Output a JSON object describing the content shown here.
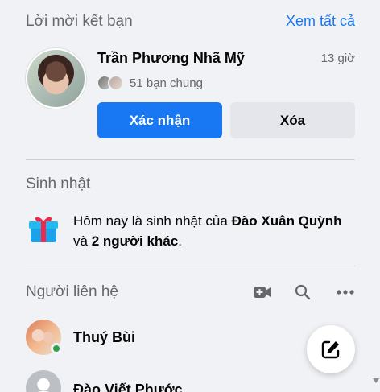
{
  "friend_requests": {
    "title": "Lời mời kết bạn",
    "see_all": "Xem tất cả",
    "request": {
      "name": "Trần Phương Nhã Mỹ",
      "time": "13 giờ",
      "mutual": "51 bạn chung",
      "confirm_label": "Xác nhận",
      "delete_label": "Xóa"
    }
  },
  "birthdays": {
    "title": "Sinh nhật",
    "text_prefix": "Hôm nay là sinh nhật của ",
    "name": "Đào Xuân Quỳnh",
    "text_middle": " và ",
    "others": "2 người khác",
    "text_suffix": "."
  },
  "contacts": {
    "title": "Người liên hệ",
    "icons": [
      "video-call-icon",
      "search-icon",
      "more-icon"
    ],
    "items": [
      {
        "name": "Thuý Bùi",
        "online": true
      },
      {
        "name": "Đào Viết Phước",
        "online": false
      }
    ]
  },
  "colors": {
    "accent": "#1877f2",
    "background": "#f0f2f5",
    "online": "#31a24c"
  }
}
